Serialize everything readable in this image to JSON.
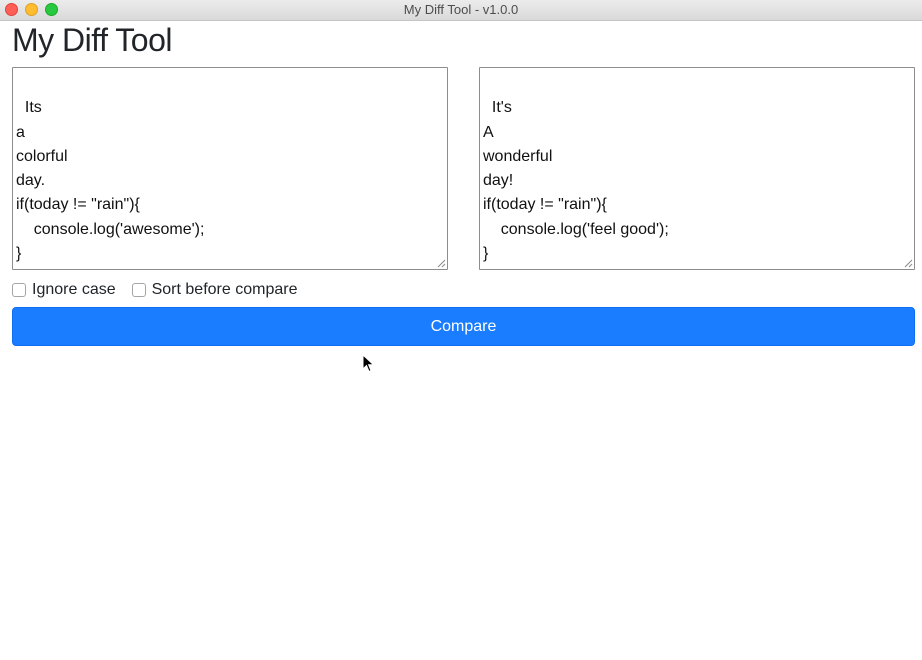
{
  "window": {
    "title": "My Diff Tool - v1.0.0"
  },
  "app": {
    "heading": "My Diff Tool"
  },
  "editors": {
    "left": {
      "content": "Its\na\ncolorful\nday.\nif(today != \"rain\"){\n    console.log('awesome');\n}"
    },
    "right": {
      "content": "It's\nA\nwonderful\nday!\nif(today != \"rain\"){\n    console.log('feel good');\n}"
    }
  },
  "options": {
    "ignore_case": {
      "label": "Ignore case",
      "checked": false
    },
    "sort_before_compare": {
      "label": "Sort before compare",
      "checked": false
    }
  },
  "actions": {
    "compare_label": "Compare"
  },
  "colors": {
    "primary_button": "#1a7cff",
    "close": "#fe5f57",
    "minimize": "#febc2e",
    "maximize": "#28c840"
  }
}
